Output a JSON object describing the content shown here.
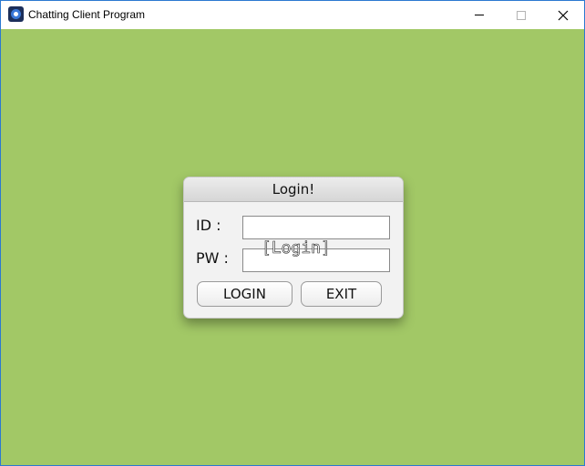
{
  "window": {
    "title": "Chatting Client Program",
    "controls": {
      "minimize": "minimize",
      "maximize": "maximize",
      "close": "close"
    }
  },
  "colors": {
    "background": "#a2c866",
    "window_border": "#2b79d1"
  },
  "login_dialog": {
    "title": "Login!",
    "id_label": "ID :",
    "pw_label": "PW :",
    "id_value": "",
    "pw_value": "",
    "overlay_text": "[Login]",
    "login_button": "LOGIN",
    "exit_button": "EXIT"
  }
}
